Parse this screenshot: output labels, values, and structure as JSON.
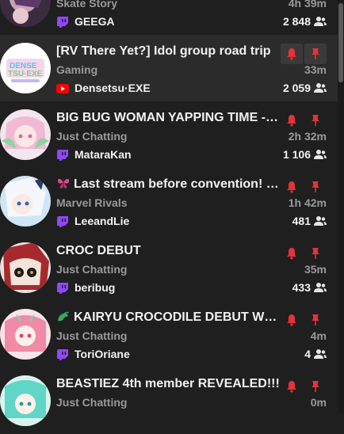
{
  "colors": {
    "accent": "#e53238",
    "twitch": "#9146ff",
    "youtube": "#ff0000"
  },
  "streams": [
    {
      "title": "",
      "category": "Skate Story",
      "duration": "4h 39m",
      "platform": "twitch-icon",
      "channel": "GEEGA",
      "viewers": "2 848"
    },
    {
      "title": "[RV There Yet?] Idol group road trip",
      "category": "Gaming",
      "duration": "33m",
      "platform": "youtube-icon",
      "channel": "Densetsu·EXE",
      "viewers": "2 059",
      "highlighted": true
    },
    {
      "title": "BIG BUG WOMAN YAPPING TIME - !plushie",
      "category": "Just Chatting",
      "duration": "2h 32m",
      "platform": "twitch-icon",
      "channel": "MataraKan",
      "viewers": "1 106"
    },
    {
      "title": "Last stream before convention! !social",
      "title_icon": "butterfly-icon",
      "category": "Marvel Rivals",
      "duration": "1h 42m",
      "platform": "twitch-icon",
      "channel": "LeeandLie",
      "viewers": "481"
    },
    {
      "title": "CROC DEBUT",
      "category": "Just Chatting",
      "duration": "35m",
      "platform": "twitch-icon",
      "channel": "beribug",
      "viewers": "433"
    },
    {
      "title": "KAIRYU CROCODILE DEBUT WOO HOO",
      "title_icon": "dragon-icon",
      "category": "Just Chatting",
      "duration": "4m",
      "platform": "twitch-icon",
      "channel": "ToriOriane",
      "viewers": "4"
    },
    {
      "title": "BEASTIEZ 4th member REVEALED!!!",
      "category": "Just Chatting",
      "duration": "0m",
      "platform": "twitch-icon",
      "channel": "",
      "viewers": ""
    }
  ]
}
